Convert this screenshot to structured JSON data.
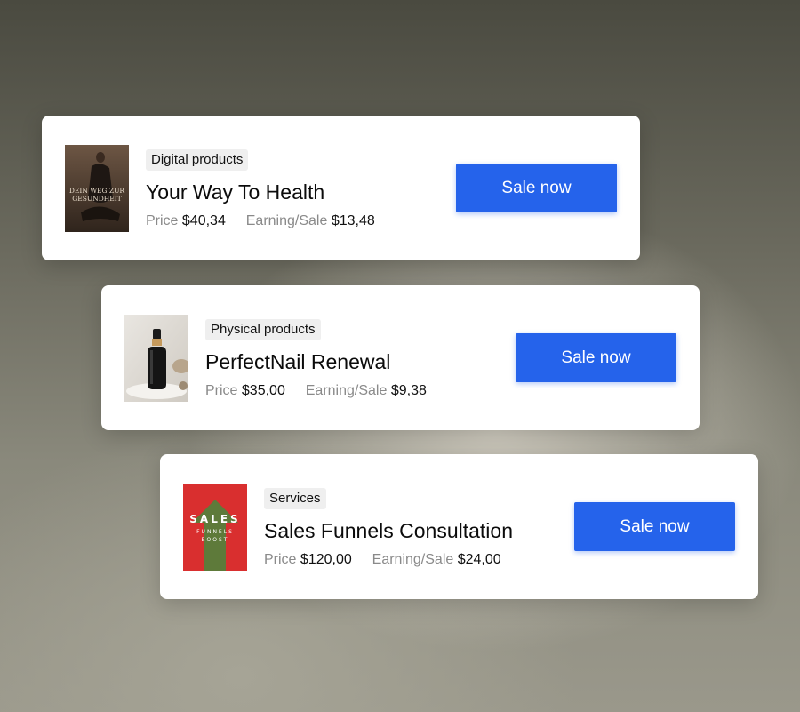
{
  "products": [
    {
      "category": "Digital products",
      "title": "Your Way To Health",
      "price_label": "Price",
      "price": "$40,34",
      "earning_label": "Earning/Sale",
      "earning": "$13,48",
      "button_label": "Sale now",
      "cover_text": "DEIN WEG ZUR GESUNDHEIT"
    },
    {
      "category": "Physical products",
      "title": "PerfectNail Renewal",
      "price_label": "Price",
      "price": "$35,00",
      "earning_label": "Earning/Sale",
      "earning": "$9,38",
      "button_label": "Sale now"
    },
    {
      "category": "Services",
      "title": "Sales Funnels Consultation",
      "price_label": "Price",
      "price": "$120,00",
      "earning_label": "Earning/Sale",
      "earning": "$24,00",
      "button_label": "Sale now",
      "cover_title": "SALES",
      "cover_sub1": "FUNNELS",
      "cover_sub2": "BOOST"
    }
  ],
  "colors": {
    "accent": "#2563eb",
    "tag_bg": "#efefef",
    "muted_text": "#8a8a8a"
  }
}
